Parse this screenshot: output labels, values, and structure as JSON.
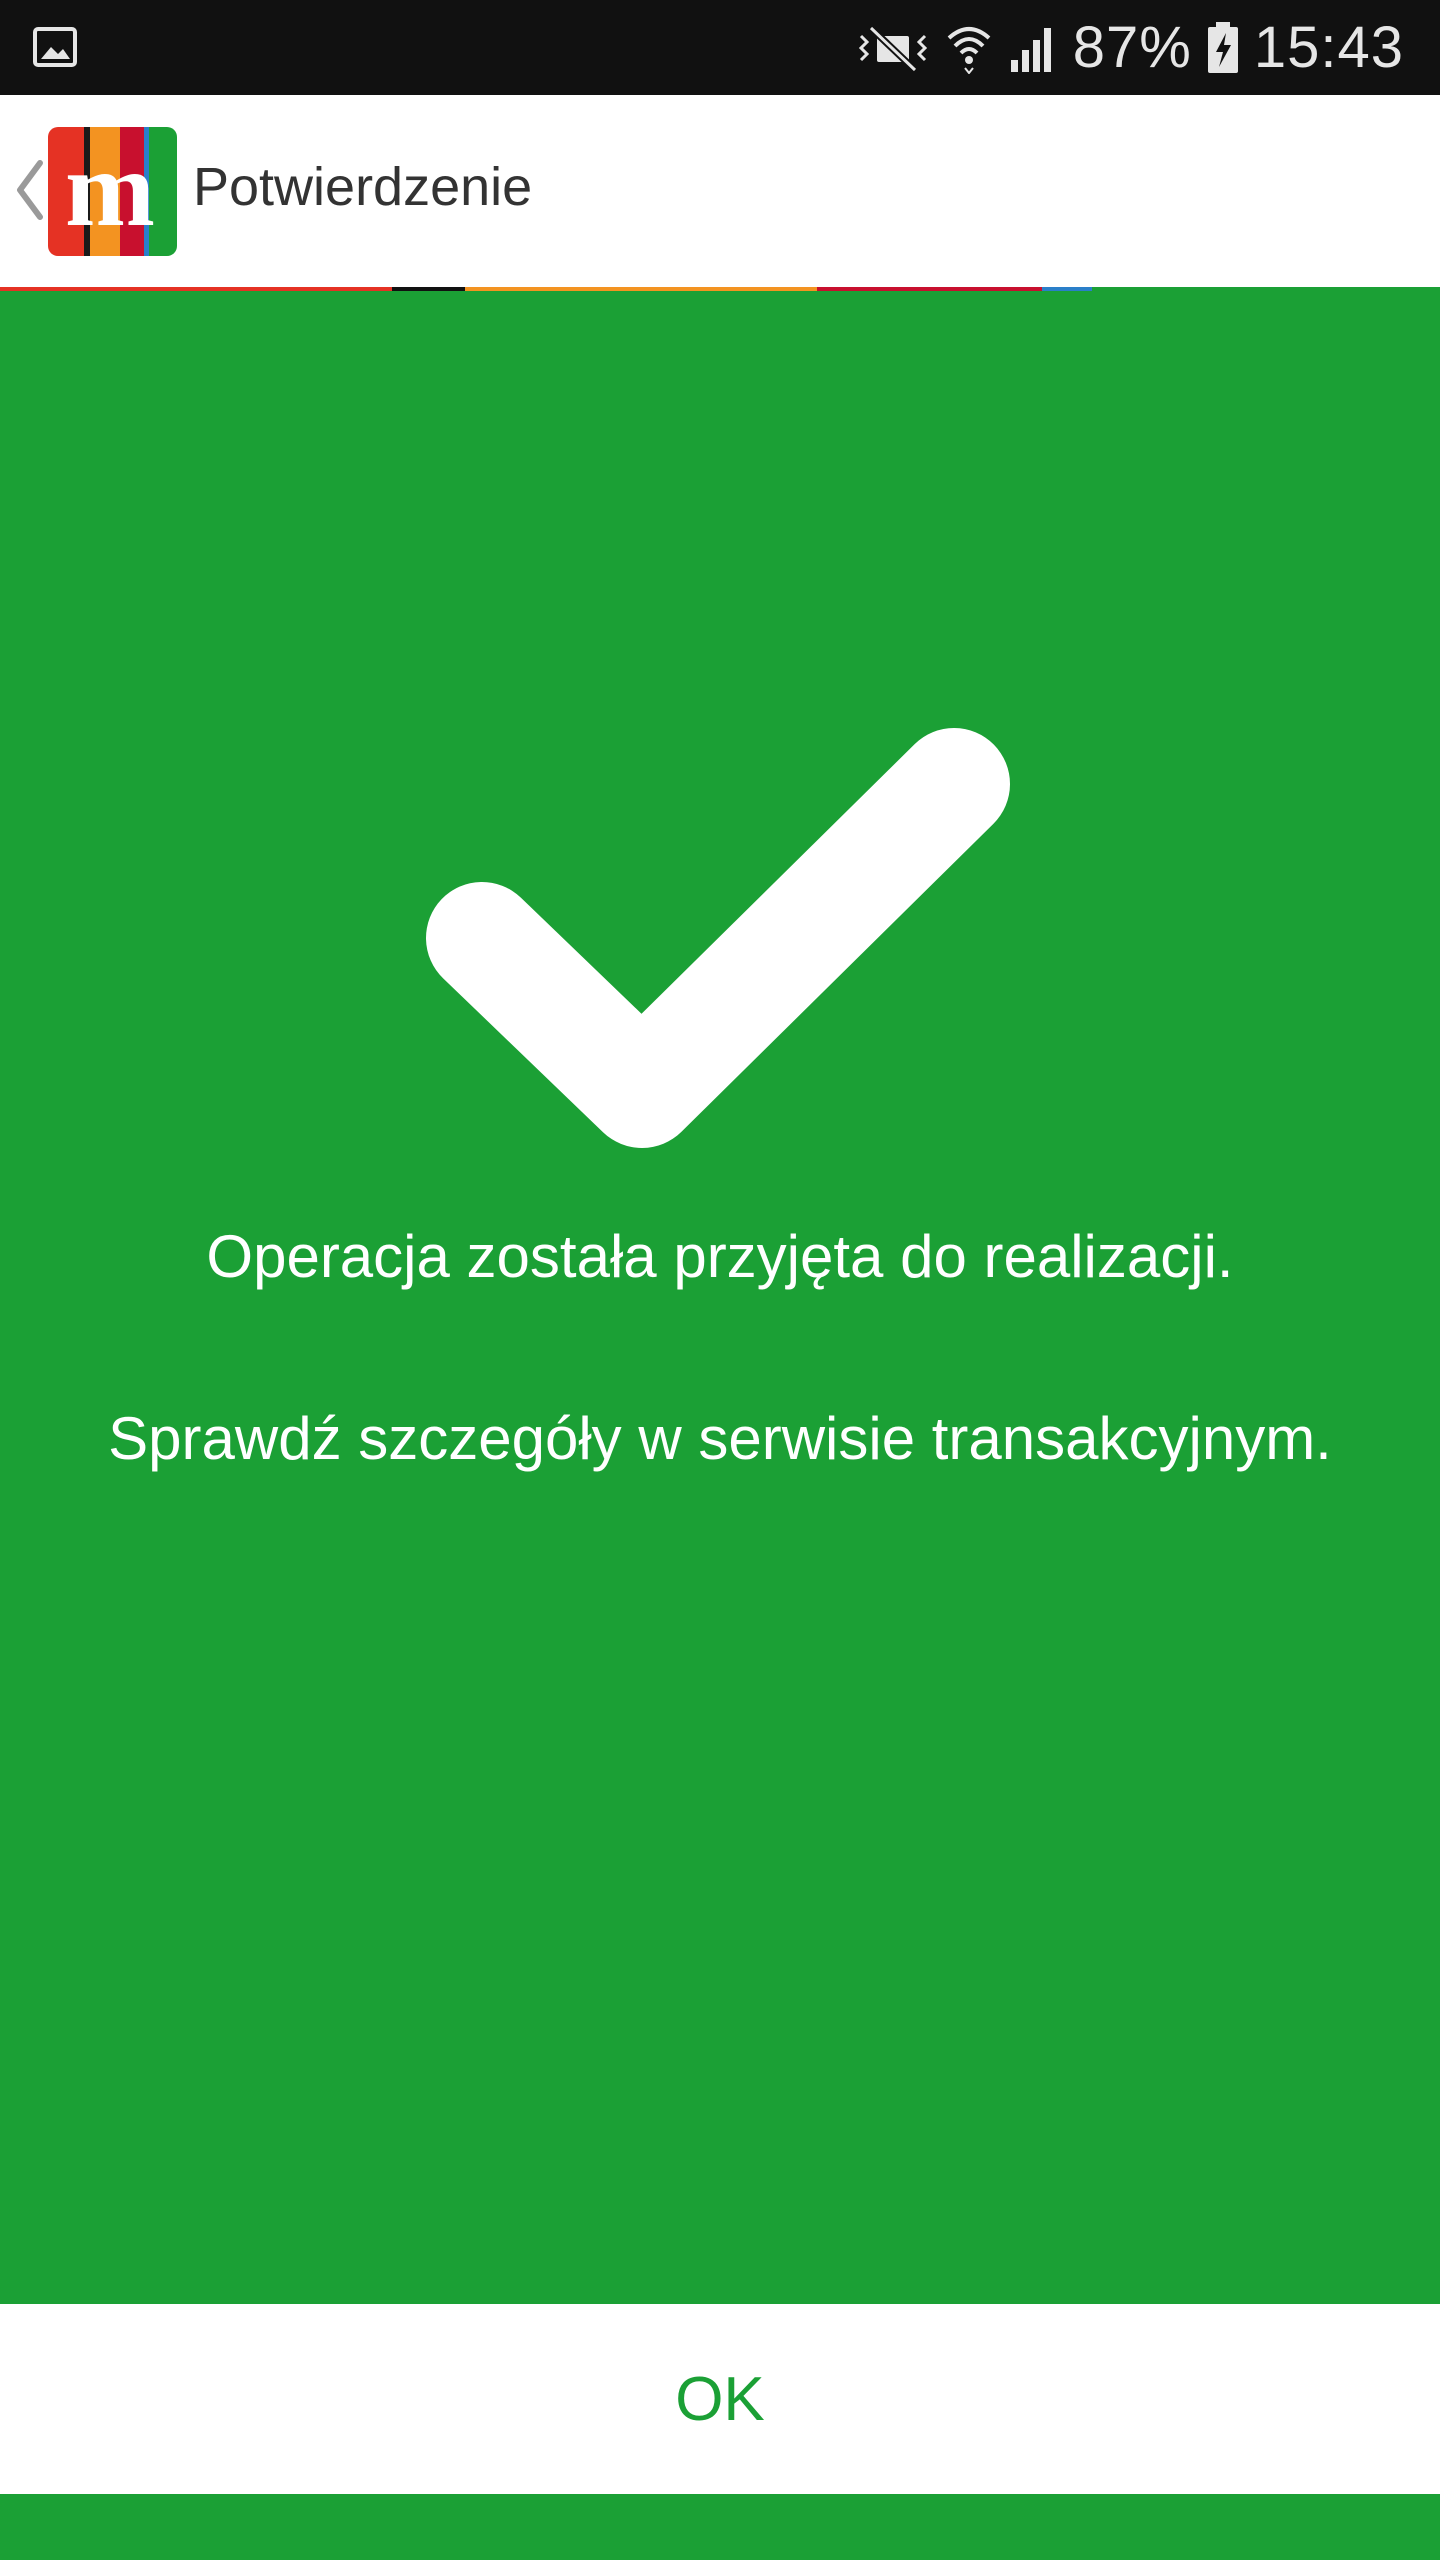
{
  "status_bar": {
    "battery_percent": "87%",
    "time": "15:43",
    "icons": [
      "gallery-icon",
      "vibrate-mute-icon",
      "wifi-icon",
      "signal-icon",
      "battery-charging-icon"
    ]
  },
  "header": {
    "title": "Potwierdzenie",
    "logo_letter": "m",
    "back_icon": "chevron-left-icon"
  },
  "main": {
    "icon": "check-icon",
    "message_primary": "Operacja została przyjęta do realizacji.",
    "message_secondary": "Sprawdź szczegóły w serwisie transakcyjnym."
  },
  "footer": {
    "ok_label": "OK"
  },
  "colors": {
    "accent_green": "#1ba035",
    "status_bar_bg": "#111111",
    "header_bg": "#ffffff",
    "title_text": "#333333",
    "logo_red": "#e53224",
    "logo_orange": "#f39321",
    "logo_crimson": "#c8102e",
    "logo_blue": "#2a7fc9",
    "logo_green": "#1ba035"
  }
}
